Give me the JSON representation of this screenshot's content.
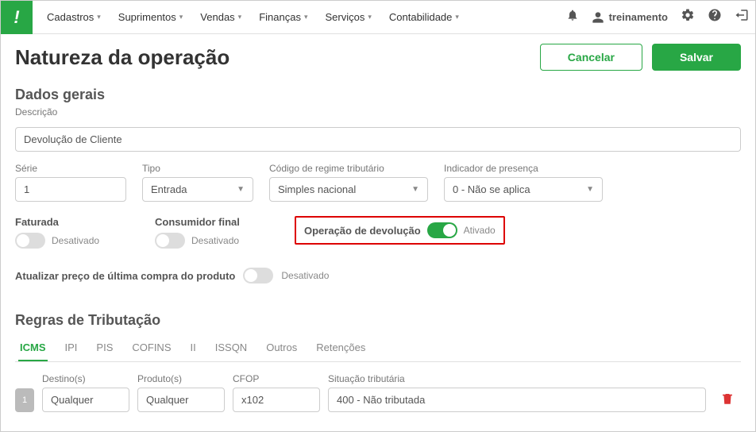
{
  "topnav": {
    "items": [
      {
        "label": "Cadastros"
      },
      {
        "label": "Suprimentos"
      },
      {
        "label": "Vendas"
      },
      {
        "label": "Finanças"
      },
      {
        "label": "Serviços"
      },
      {
        "label": "Contabilidade"
      }
    ],
    "user": "treinamento"
  },
  "page": {
    "title": "Natureza da operação",
    "cancel": "Cancelar",
    "save": "Salvar"
  },
  "general": {
    "section": "Dados gerais",
    "desc_label": "Descrição",
    "desc_value": "Devolução de Cliente",
    "serie_label": "Série",
    "serie_value": "1",
    "tipo_label": "Tipo",
    "tipo_value": "Entrada",
    "regime_label": "Código de regime tributário",
    "regime_value": "Simples nacional",
    "indicador_label": "Indicador de presença",
    "indicador_value": "0 - Não se aplica",
    "faturada_label": "Faturada",
    "faturada_state": "Desativado",
    "consumidor_label": "Consumidor final",
    "consumidor_state": "Desativado",
    "devolucao_label": "Operação de devolução",
    "devolucao_state": "Ativado",
    "update_label": "Atualizar preço de última compra do produto",
    "update_state": "Desativado"
  },
  "regras": {
    "title": "Regras de Tributação",
    "tabs": [
      "ICMS",
      "IPI",
      "PIS",
      "COFINS",
      "II",
      "ISSQN",
      "Outros",
      "Retenções"
    ],
    "headers": {
      "destino": "Destino(s)",
      "produto": "Produto(s)",
      "cfop": "CFOP",
      "situacao": "Situação tributária"
    },
    "rows": [
      {
        "idx": "1",
        "destino": "Qualquer",
        "produto": "Qualquer",
        "cfop": "x102",
        "situacao": "400 - Não tributada"
      }
    ]
  }
}
